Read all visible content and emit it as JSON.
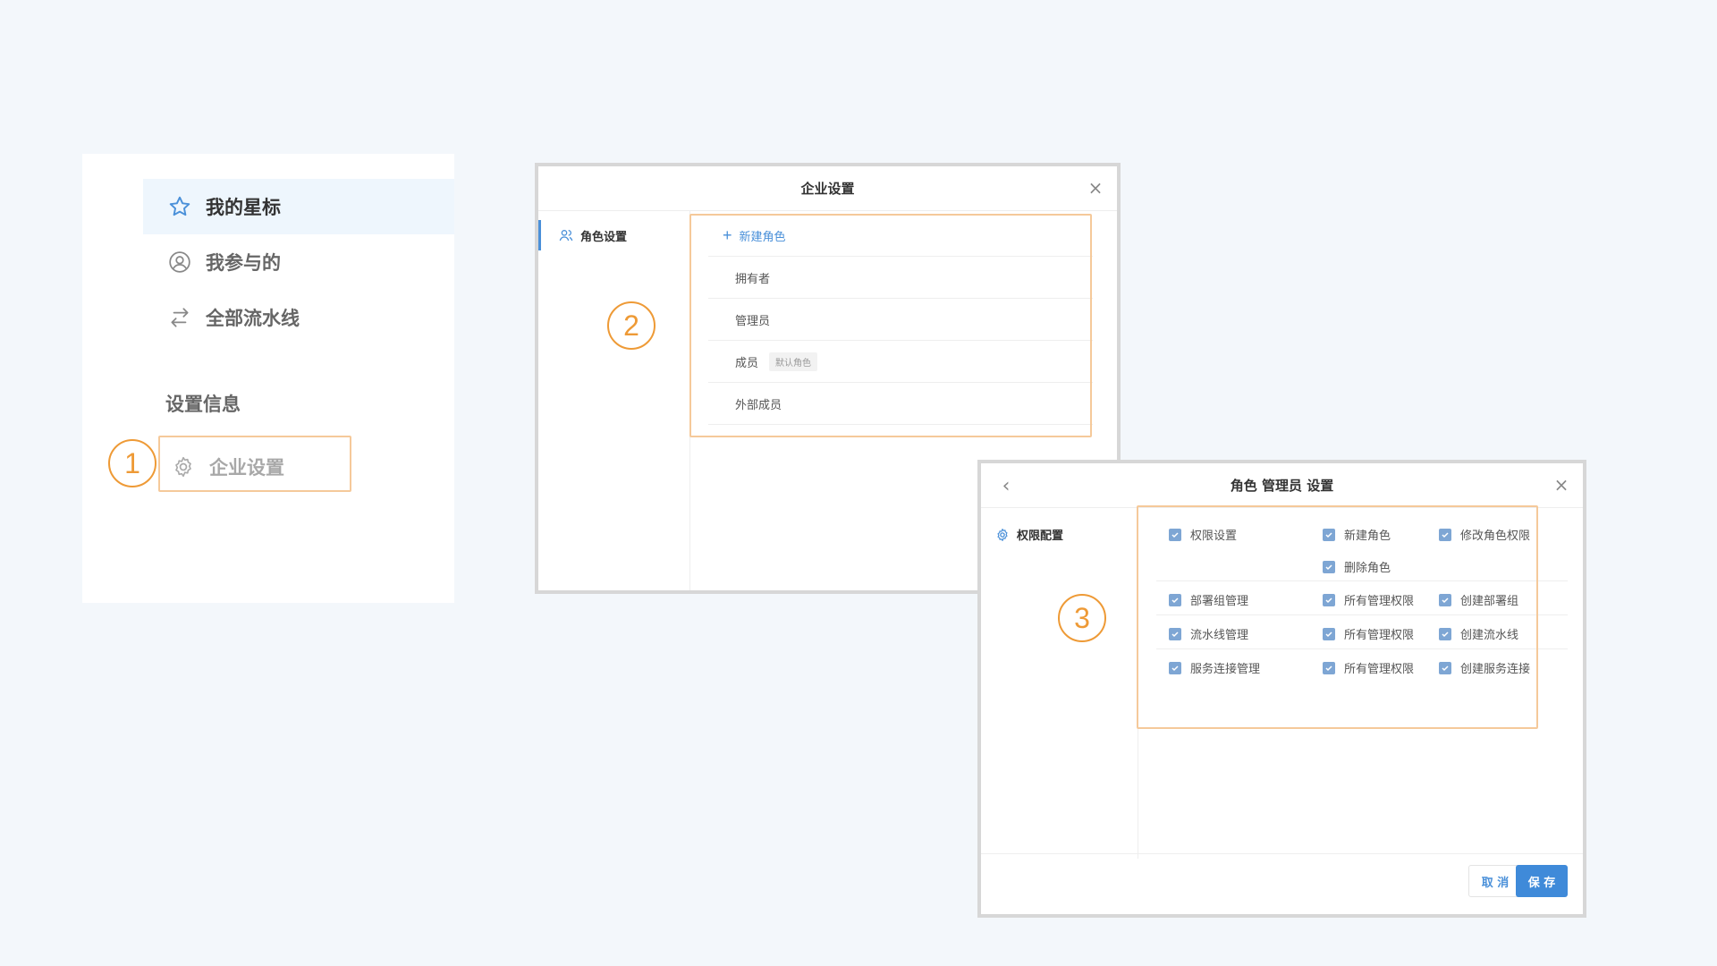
{
  "sidebar": {
    "items": [
      {
        "label": "我的星标",
        "icon": "star-icon"
      },
      {
        "label": "我参与的",
        "icon": "user-circle-icon"
      },
      {
        "label": "全部流水线",
        "icon": "pipeline-arrows-icon"
      }
    ],
    "section_title": "设置信息",
    "enterprise_item": {
      "label": "企业设置",
      "icon": "gear-icon"
    }
  },
  "steps": [
    "1",
    "2",
    "3"
  ],
  "dialog1": {
    "title": "企业设置",
    "close": "×",
    "nav_item": {
      "label": "角色设置",
      "icon": "users-icon"
    },
    "new_role": "新建角色",
    "new_role_icon": "plus-icon",
    "roles": [
      {
        "label": "拥有者",
        "badge": ""
      },
      {
        "label": "管理员",
        "badge": ""
      },
      {
        "label": "成员",
        "badge": "默认角色"
      },
      {
        "label": "外部成员",
        "badge": ""
      }
    ]
  },
  "dialog2": {
    "title": "角色 管理员 设置",
    "back": "‹",
    "close": "×",
    "nav_item": {
      "label": "权限配置",
      "icon": "gear-icon"
    },
    "permissions": {
      "row1": {
        "main": "权限设置",
        "a": "新建角色",
        "b": "修改角色权限",
        "c": "删除角色"
      },
      "row2": {
        "main": "部署组管理",
        "a": "所有管理权限",
        "b": "创建部署组"
      },
      "row3": {
        "main": "流水线管理",
        "a": "所有管理权限",
        "b": "创建流水线"
      },
      "row4": {
        "main": "服务连接管理",
        "a": "所有管理权限",
        "b": "创建服务连接"
      }
    },
    "cancel_label": "取 消",
    "save_label": "保 存"
  },
  "colors": {
    "accent": "#3f8ad9",
    "highlight_border": "#f5c99a",
    "step_circle": "#ee9a36",
    "checkbox": "#7ea6d4"
  }
}
